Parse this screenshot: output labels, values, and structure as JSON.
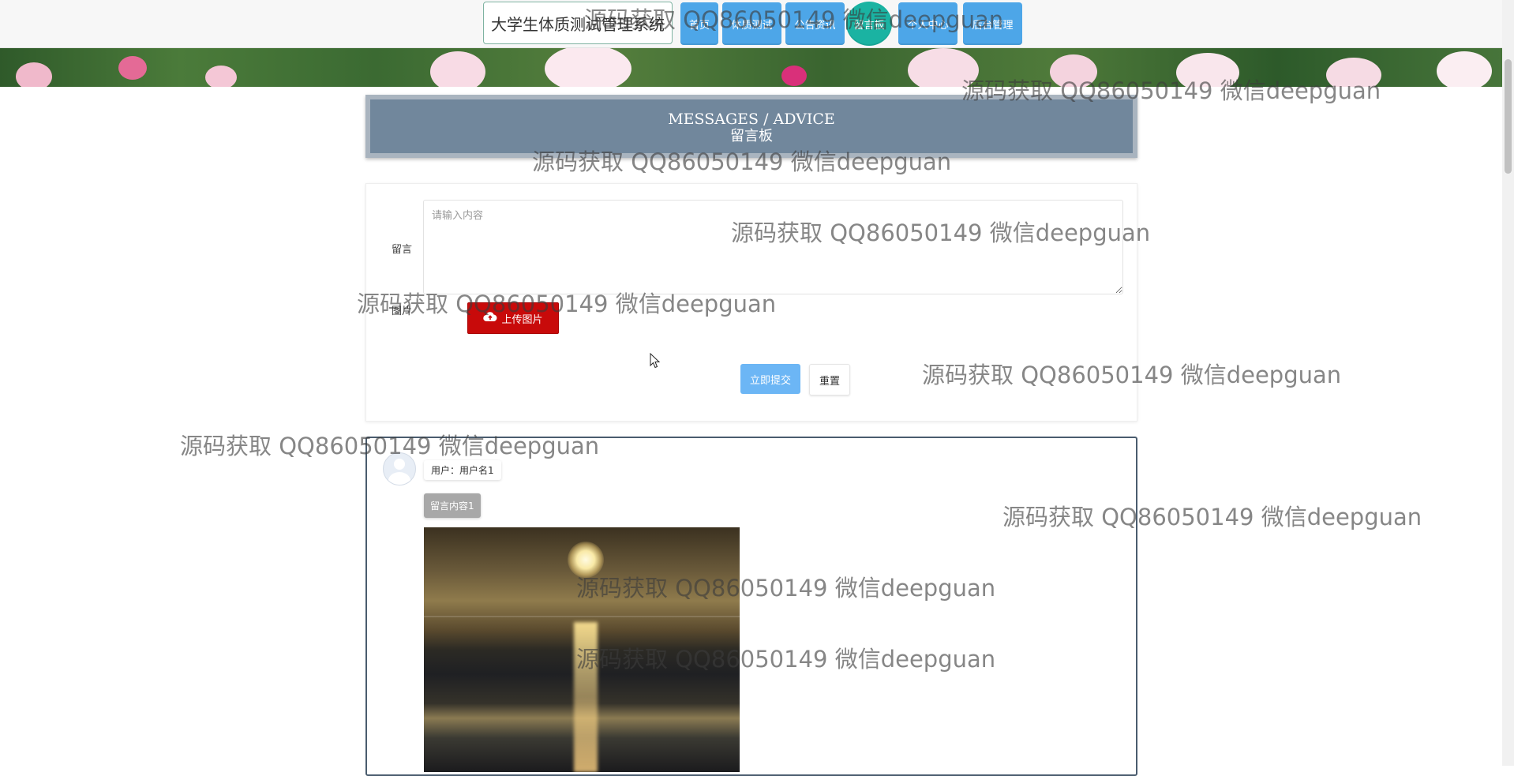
{
  "header": {
    "brand": "大学生体质测试管理系统",
    "nav": [
      {
        "label": "首页",
        "active": false
      },
      {
        "label": "体质测试",
        "active": false
      },
      {
        "label": "公告资讯",
        "active": false
      },
      {
        "label": "留言板",
        "active": true
      },
      {
        "label": "个人中心",
        "active": false
      },
      {
        "label": "后台管理",
        "active": false
      }
    ]
  },
  "title": {
    "en": "MESSAGES / ADVICE",
    "cn": "留言板"
  },
  "form": {
    "message_label": "留言",
    "message_placeholder": "请输入内容",
    "image_label": "图片",
    "upload_label": "上传图片",
    "submit_label": "立即提交",
    "reset_label": "重置"
  },
  "messages": [
    {
      "user": "用户：用户名1",
      "content": "留言内容1"
    }
  ],
  "watermark": "源码获取 QQ86050149 微信deepguan",
  "colors": {
    "nav_blue": "#4da6e8",
    "nav_active": "#1ab3a2",
    "title_panel": "#71879c",
    "upload_red": "#c80a0a",
    "submit_blue": "#6cb6f5"
  }
}
